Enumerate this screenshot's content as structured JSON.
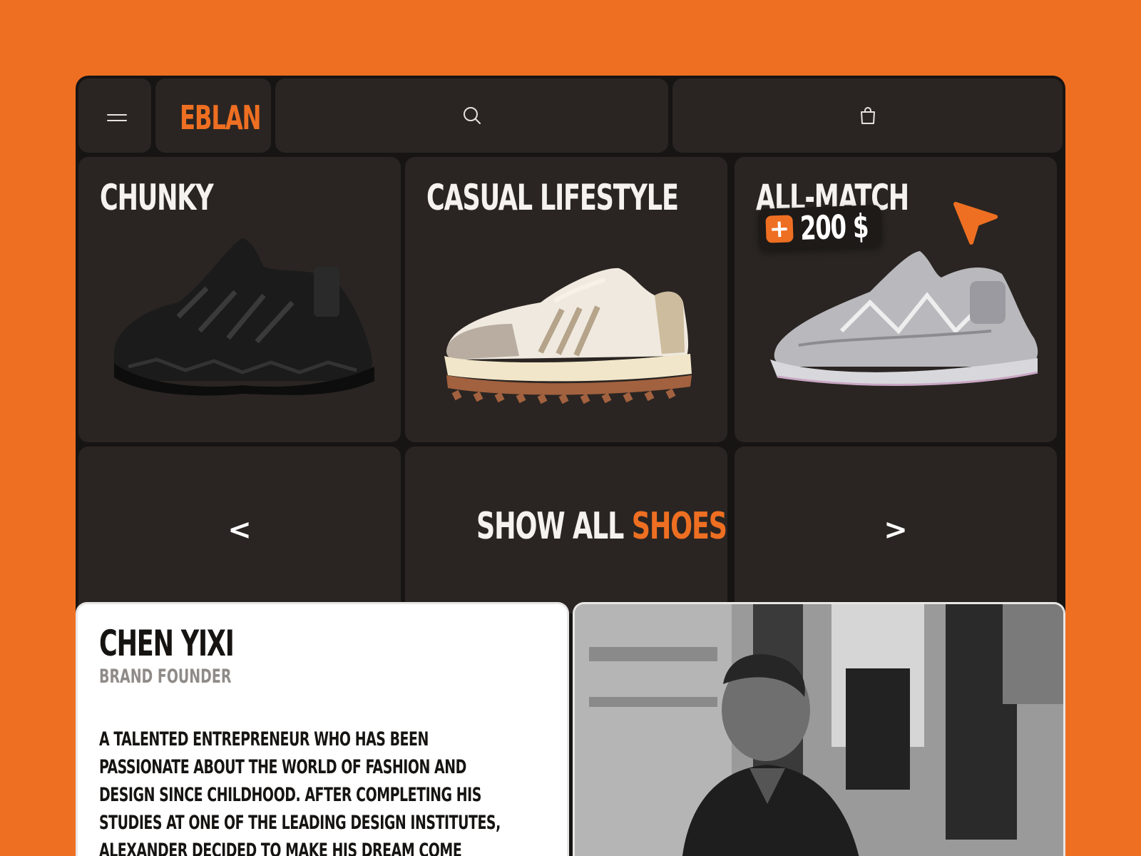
{
  "header": {
    "brand": "EBLAN"
  },
  "products": [
    {
      "title": "CHUNKY"
    },
    {
      "title": "CASUAL LIFESTYLE"
    },
    {
      "title": "ALL-MATCH",
      "price_badge": {
        "plus": "+",
        "price": "200 $"
      }
    }
  ],
  "nav": {
    "prev": "<",
    "show_all": "SHOW ALL",
    "show_all_accent": "SHOES",
    "next": ">"
  },
  "founder": {
    "name": "CHEN YIXI",
    "role": "BRAND FOUNDER",
    "bio": "A TALENTED ENTREPRENEUR WHO HAS BEEN PASSIONATE ABOUT THE WORLD OF FASHION AND DESIGN SINCE CHILDHOOD. AFTER COMPLETING HIS STUDIES AT ONE OF THE LEADING DESIGN INSTITUTES, ALEXANDER DECIDED TO MAKE HIS DREAM COME"
  },
  "icons": {
    "menu": "hamburger-icon",
    "search": "search-icon",
    "cart": "shopping-bag-icon",
    "cursor": "pointer-arrow-icon"
  },
  "colors": {
    "accent": "#ee6f22",
    "tile": "#2a2522",
    "frame": "#171514",
    "text_light": "#f5f2ef"
  }
}
